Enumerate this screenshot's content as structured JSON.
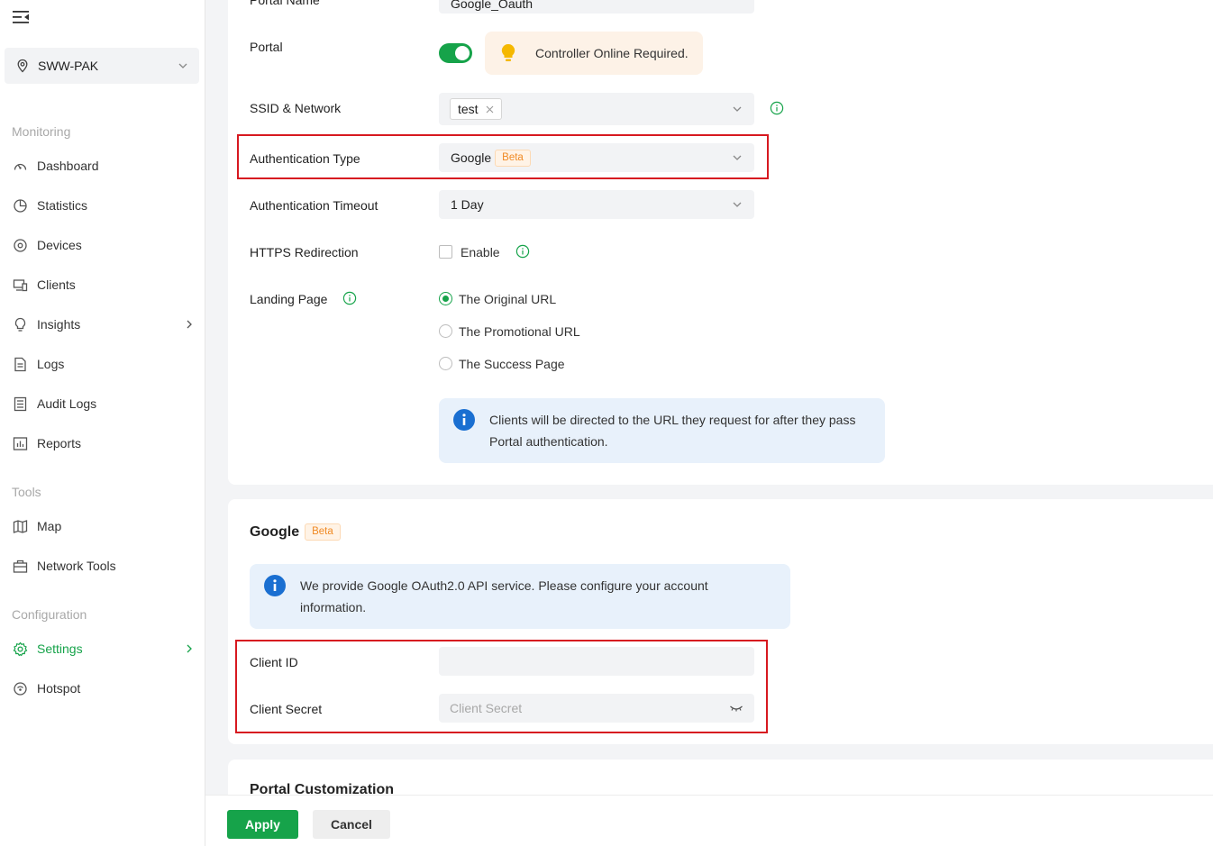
{
  "sidebar": {
    "site": "SWW-PAK",
    "sections": {
      "monitoring": "Monitoring",
      "tools": "Tools",
      "configuration": "Configuration"
    },
    "items": {
      "dashboard": "Dashboard",
      "statistics": "Statistics",
      "devices": "Devices",
      "clients": "Clients",
      "insights": "Insights",
      "logs": "Logs",
      "audit_logs": "Audit Logs",
      "reports": "Reports",
      "map": "Map",
      "network_tools": "Network Tools",
      "settings": "Settings",
      "hotspot": "Hotspot"
    },
    "active_item": "Settings",
    "accent_color": "#16a34a"
  },
  "portal_form": {
    "portal_name_label": "Portal Name",
    "portal_name_value": "Google_Oauth",
    "portal_label": "Portal",
    "portal_enabled": true,
    "notice": "Controller Online Required.",
    "ssid_label": "SSID & Network",
    "ssid_tag": "test",
    "auth_type_label": "Authentication Type",
    "auth_type_value": "Google",
    "beta_badge": "Beta",
    "auth_timeout_label": "Authentication Timeout",
    "auth_timeout_value": "1 Day",
    "https_label": "HTTPS Redirection",
    "https_enable_label": "Enable",
    "https_enabled": false,
    "landing_label": "Landing Page",
    "landing_options": [
      "The Original URL",
      "The Promotional URL",
      "The Success Page"
    ],
    "landing_selected": "The Original URL",
    "landing_info": "Clients will be directed to the URL they request for after they pass Portal authentication."
  },
  "google_section": {
    "title": "Google",
    "beta_badge": "Beta",
    "info": "We provide Google OAuth2.0 API service. Please configure your account information.",
    "client_id_label": "Client ID",
    "client_id_value": "",
    "client_secret_label": "Client Secret",
    "client_secret_placeholder": "Client Secret"
  },
  "customization": {
    "title": "Portal Customization"
  },
  "footer": {
    "apply": "Apply",
    "cancel": "Cancel"
  },
  "colors": {
    "primary": "#16a34a",
    "highlight_border": "#d71920",
    "info_blue": "#1a6fd1",
    "beta_orange": "#f08a24"
  }
}
